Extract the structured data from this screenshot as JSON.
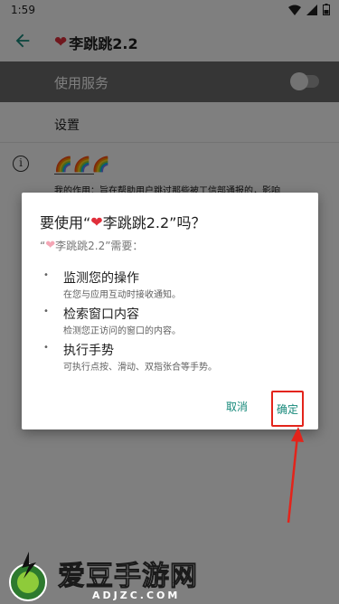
{
  "status_bar": {
    "time": "1:59"
  },
  "app_bar": {
    "heart": "❤",
    "title": "李跳跳2.2"
  },
  "service_row": {
    "label": "使用服务"
  },
  "settings_row": {
    "label": "设置"
  },
  "info_row": {
    "icon": "i",
    "rainbow": "🌈🌈🌈",
    "description": "我的作用：旨在帮助用户跳过那些被工信部通报的，影响"
  },
  "dialog": {
    "title_prefix": "要使用“",
    "heart": "❤",
    "title_app": "李跳跳2.2",
    "title_suffix": "”吗？",
    "sub_prefix": "“",
    "sub_heart": "❤",
    "sub_app": "李跳跳2.2”需要：",
    "permissions": [
      {
        "title": "监测您的操作",
        "desc": "在您与应用互动时接收通知。"
      },
      {
        "title": "检索窗口内容",
        "desc": "检测您正访问的窗口的内容。"
      },
      {
        "title": "执行手势",
        "desc": "可执行点按、滑动、双指张合等手势。"
      }
    ],
    "cancel_label": "取消",
    "ok_label": "确定"
  },
  "watermark": {
    "brand": "爱豆手游网",
    "url": "ADJZC.COM"
  },
  "colors": {
    "accent": "#16897a",
    "highlight": "#e3241b",
    "heart": "#e02e3a"
  }
}
